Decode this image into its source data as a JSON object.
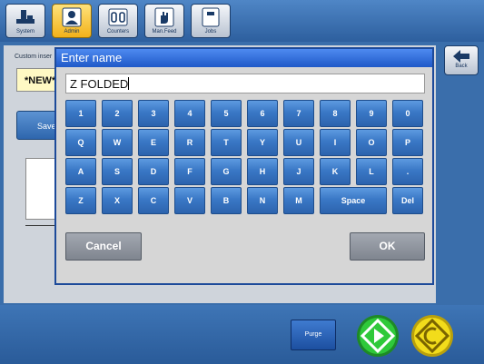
{
  "toolbar": {
    "buttons": [
      {
        "label": "System",
        "icon": "system-icon"
      },
      {
        "label": "Admin",
        "icon": "admin-icon",
        "active": true
      },
      {
        "label": "Counters",
        "icon": "counters-icon"
      },
      {
        "label": "Man.Feed",
        "icon": "hand-icon"
      },
      {
        "label": "Jobs",
        "icon": "jobs-icon"
      }
    ]
  },
  "background": {
    "custom_label": "Custom inser",
    "name_value": "*NEW*",
    "save_label": "Save",
    "back_label": "Back"
  },
  "dialog": {
    "title": "Enter name",
    "input_value": "Z FOLDED",
    "rows": [
      [
        "1",
        "2",
        "3",
        "4",
        "5",
        "6",
        "7",
        "8",
        "9",
        "0"
      ],
      [
        "Q",
        "W",
        "E",
        "R",
        "T",
        "Y",
        "U",
        "I",
        "O",
        "P"
      ],
      [
        "A",
        "S",
        "D",
        "F",
        "G",
        "H",
        "J",
        "K",
        "L",
        "."
      ],
      [
        "Z",
        "X",
        "C",
        "V",
        "B",
        "N",
        "M",
        "Space",
        "Del"
      ]
    ],
    "cancel_label": "Cancel",
    "ok_label": "OK"
  },
  "bottom": {
    "purge_label": "Purge",
    "start_icon": "start-icon",
    "stop_icon": "stop-icon"
  },
  "colors": {
    "accent_blue": "#3a78c6",
    "start_green": "#2fc93a",
    "stop_yellow": "#f2dc1b"
  }
}
